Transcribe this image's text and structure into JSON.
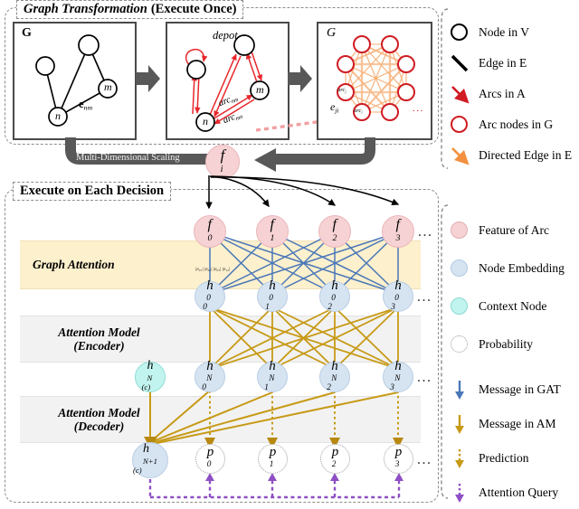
{
  "sections": {
    "top": {
      "title_italic": "Graph Transformation",
      "title_bold": "(Execute Once)"
    },
    "bottom": {
      "title_bold": "Execute on Each Decision"
    }
  },
  "panels": {
    "original_graph": {
      "tag": "G",
      "edge_label_base": "e",
      "edge_label_sub": "nm",
      "node_m": "m",
      "node_n": "n"
    },
    "arc_graph": {
      "depot": "depot",
      "arc_nm": "arc",
      "arc_nm_sub": "nm",
      "arc_mn": "arc",
      "arc_mn_sub": "mn"
    },
    "transformed_graph": {
      "tag": "G",
      "arc_j": "arc",
      "arc_j_sub": "j",
      "arc_i": "arc",
      "arc_i_sub": "i",
      "edge_label_base": "e",
      "edge_label_sub": "ji",
      "ellipsis": "..."
    }
  },
  "mds_arrow_label": "Multi-Dimensional Scaling",
  "feature_node": {
    "base": "f",
    "sub": "i"
  },
  "bands": {
    "graph_attention": "Graph Attention",
    "encoder": "Attention Model\n(Encoder)",
    "decoder": "Attention Model\n(Decoder)"
  },
  "gat_edge_weights": "|e₀₁| |e₀₂| |e₀₃| |e₁₂|",
  "rows": {
    "features": {
      "base": "f",
      "subs": [
        "0",
        "1",
        "2",
        "3"
      ],
      "ellipsis": "..."
    },
    "h0": {
      "base": "h",
      "sup": "0",
      "subs": [
        "0",
        "1",
        "2",
        "3"
      ],
      "ellipsis": "..."
    },
    "hN": {
      "base": "h",
      "sup": "N",
      "subs": [
        "0",
        "1",
        "2",
        "3"
      ],
      "ellipsis": "..."
    },
    "probs": {
      "base": "p",
      "subs": [
        "0",
        "1",
        "2",
        "3"
      ],
      "ellipsis": "..."
    }
  },
  "context": {
    "encoder_ctx": {
      "base": "h",
      "sup": "N",
      "sub": "(c)"
    },
    "decoder_ctx": {
      "base": "h",
      "sup": "N+1",
      "sub": "(c)"
    }
  },
  "legend": {
    "group1": [
      {
        "label": "Node in V",
        "icon": "open-circle-black"
      },
      {
        "label": "Edge in E",
        "icon": "diagonal-line-black"
      },
      {
        "label": "Arcs in A",
        "icon": "red-arrow"
      },
      {
        "label": "Arc nodes in G",
        "icon": "open-circle-red"
      },
      {
        "label": "Directed Edge in E",
        "icon": "orange-arrow"
      }
    ],
    "group2": [
      {
        "label": "Feature of Arc",
        "icon": "pink-filled-circle"
      },
      {
        "label": "Node Embedding",
        "icon": "blue-filled-circle"
      },
      {
        "label": "Context Node",
        "icon": "cyan-filled-circle"
      },
      {
        "label": "Probability",
        "icon": "dotted-circle"
      }
    ],
    "group3": [
      {
        "label": "Message in GAT",
        "icon": "blue-down-arrow"
      },
      {
        "label": "Message in AM",
        "icon": "gold-down-arrow"
      },
      {
        "label": "Prediction",
        "icon": "gold-dotted-down-arrow"
      },
      {
        "label": "Attention Query",
        "icon": "purple-dotted-down-arrow"
      }
    ]
  },
  "colors": {
    "arc_red": "#e8262b",
    "orange_edge": "#f5a25d",
    "gat_blue": "#4a78b8",
    "am_gold": "#c79a16",
    "attention_purple": "#8e4fc4",
    "feature_pink": "#f6d2d4",
    "embedding_blue": "#d6e4f2",
    "context_cyan": "#c2f4ef",
    "band_yellow": "#fdf0cd",
    "band_gray": "#f2f2f2",
    "arrow_gray": "#585858"
  }
}
